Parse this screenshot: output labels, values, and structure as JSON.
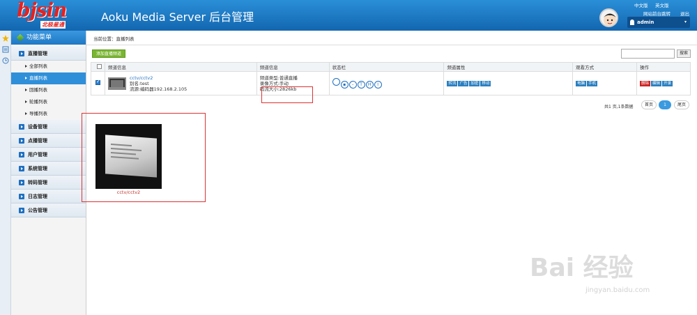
{
  "header": {
    "logo_text": "bjsin",
    "logo_sub": "北极星通",
    "app_title": "Aoku Media Server 后台管理",
    "lang_cn": "中文版",
    "lang_en": "英文版",
    "site_jump": "网站前台跳转",
    "logout": "退出",
    "user": "admin"
  },
  "sidebar": {
    "title": "功能菜单",
    "groups": [
      {
        "label": "直播管理"
      },
      {
        "label": "设备管理"
      },
      {
        "label": "点播管理"
      },
      {
        "label": "用户管理"
      },
      {
        "label": "系统管理"
      },
      {
        "label": "转码管理"
      },
      {
        "label": "日志管理"
      },
      {
        "label": "公告管理"
      }
    ],
    "live_items": [
      {
        "label": "全部列表"
      },
      {
        "label": "直播列表"
      },
      {
        "label": "回播列表"
      },
      {
        "label": "轮播列表"
      },
      {
        "label": "导播列表"
      }
    ]
  },
  "main": {
    "breadcrumb": "当前位置：直播列表",
    "add_button": "添加直播频道",
    "search_button": "搜索",
    "columns": [
      "频道信息",
      "频道信息",
      "状态栏",
      "频道属性",
      "观看方式",
      "操作"
    ],
    "row": {
      "name": "cctv/cctv2",
      "alias": "别名:test",
      "source": "流源:编码器192.168.2.105",
      "type": "频道类型:普通直播",
      "record": "录像方式:手动",
      "bitrate": "码流大小:2826kb",
      "status_icons": [
        "",
        "",
        "",
        "T",
        "H",
        "I"
      ],
      "attrs": [
        "转流",
        "广告",
        "加密",
        "移动"
      ],
      "watch": [
        "电脑",
        "手机"
      ],
      "ops": [
        "删除",
        "编辑",
        "开录"
      ]
    },
    "pager": {
      "summary": "共1 页,1条数据",
      "first": "首页",
      "current": "1",
      "last": "尾页"
    },
    "thumbnail_caption": "cctv/cctv2"
  },
  "watermark": {
    "logo": "Bai 经验",
    "url": "jingyan.baidu.com"
  }
}
